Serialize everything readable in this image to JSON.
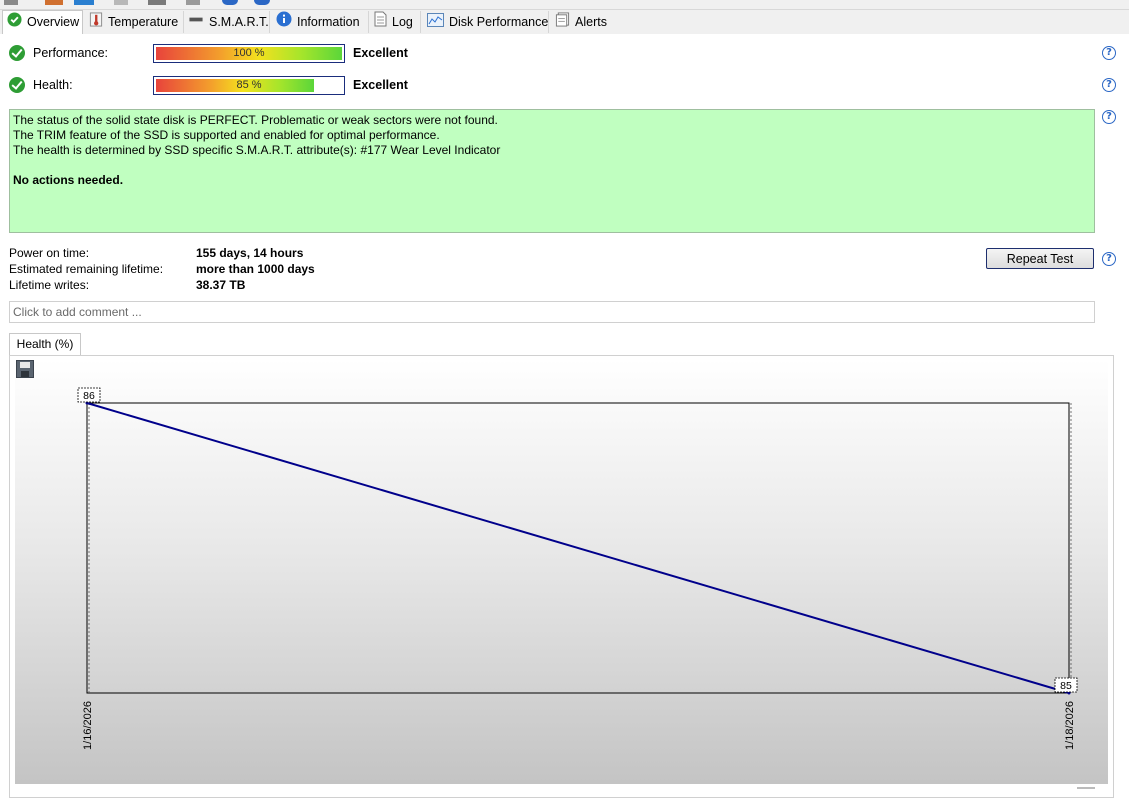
{
  "tabs": [
    {
      "label": "Overview",
      "icon": "check-circle-icon"
    },
    {
      "label": "Temperature",
      "icon": "thermometer-icon"
    },
    {
      "label": "S.M.A.R.T.",
      "icon": "disk-icon"
    },
    {
      "label": "Information",
      "icon": "info-icon"
    },
    {
      "label": "Log",
      "icon": "document-icon"
    },
    {
      "label": "Disk Performance",
      "icon": "performance-chart-icon"
    },
    {
      "label": "Alerts",
      "icon": "alerts-icon"
    }
  ],
  "performance": {
    "label": "Performance:",
    "value": 100,
    "text": "100 %",
    "verdict": "Excellent"
  },
  "health": {
    "label": "Health:",
    "value": 85,
    "text": "85 %",
    "verdict": "Excellent"
  },
  "status_box": {
    "line1": "The status of the solid state disk is PERFECT. Problematic or weak sectors were not found.",
    "line2": "The TRIM feature of the SSD is supported and enabled for optimal performance.",
    "line3": "The health is determined by SSD specific S.M.A.R.T. attribute(s):  #177 Wear Level Indicator",
    "line4": "No actions needed.",
    "background": "#c0ffc0"
  },
  "info": {
    "power_on_label": "Power on time:",
    "power_on_value": "155 days, 14 hours",
    "remaining_label": "Estimated remaining lifetime:",
    "remaining_value": "more than 1000 days",
    "writes_label": "Lifetime writes:",
    "writes_value": "38.37 TB"
  },
  "repeat_test_label": "Repeat Test",
  "comment_placeholder": "Click to add comment ...",
  "chart_tab_label": "Health (%)",
  "chart_data": {
    "type": "line",
    "x": [
      "1/16/2026",
      "1/18/2026"
    ],
    "series": [
      {
        "values": [
          86,
          85
        ]
      }
    ],
    "point_labels": [
      "86",
      "85"
    ],
    "ylim": [
      85,
      86
    ],
    "line_color": "#00008b",
    "grid": false
  },
  "colors": {
    "accent_blue": "#2b67c5",
    "ok_green": "#2e9d35",
    "line": "#00008b"
  }
}
